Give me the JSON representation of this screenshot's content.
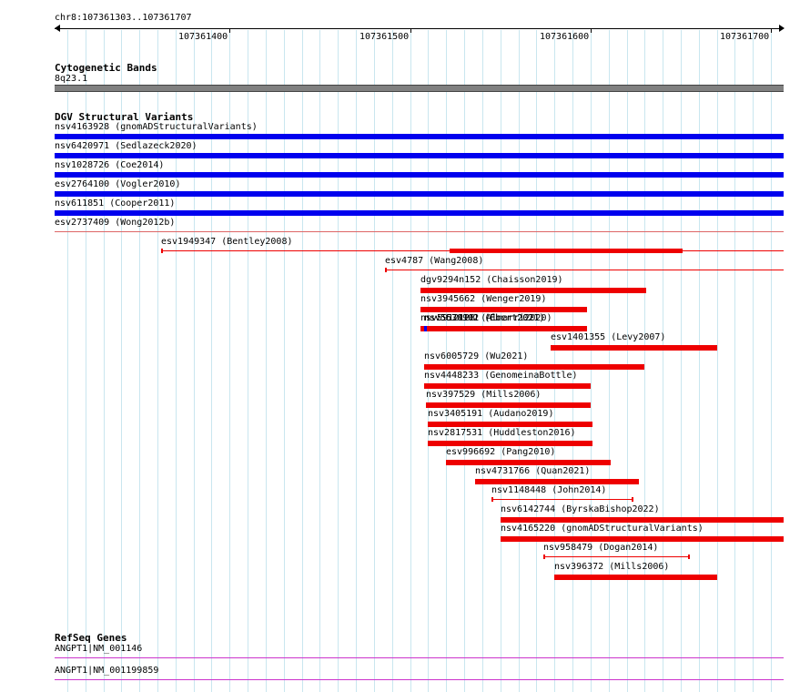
{
  "locus": "chr8:107361303..107361707",
  "scale": {
    "start": 107361303,
    "end": 107361707,
    "ticks": [
      {
        "pos": 107361400,
        "label": "107361400"
      },
      {
        "pos": 107361500,
        "label": "107361500"
      },
      {
        "pos": 107361600,
        "label": "107361600"
      },
      {
        "pos": 107361700,
        "label": "107361700"
      }
    ]
  },
  "colors": {
    "gain": "#0000ee",
    "loss": "#ee0000",
    "band": "#808080",
    "gene": "#cc33cc",
    "grid": "#c9e6ef"
  },
  "cytoband": {
    "title": "Cytogenetic Bands",
    "label": "8q23.1"
  },
  "dgv": {
    "title": "DGV Structural Variants",
    "full_span_gains": [
      {
        "label": "nsv4163928 (gnomADStructuralVariants)"
      },
      {
        "label": "nsv6420971 (Sedlazeck2020)"
      },
      {
        "label": "nsv1028726 (Coe2014)"
      },
      {
        "label": "esv2764100 (Vogler2010)"
      },
      {
        "label": "nsv611851 (Cooper2011)"
      }
    ],
    "full_span_losses": [
      {
        "label": "esv2737409 (Wong2012b)"
      }
    ],
    "features": [
      {
        "label": "esv1949347 (Bentley2008)",
        "color": "loss",
        "style": "thin",
        "start": 107361362,
        "end": 107361707,
        "thick_start": 107361522,
        "thick_end": 107361651
      },
      {
        "label": "esv4787 (Wang2008)",
        "color": "loss",
        "style": "thin",
        "start": 107361486,
        "end": 107361707
      },
      {
        "label": "dgv9294n152 (Chaisson2019)",
        "color": "loss",
        "style": "thick",
        "start": 107361506,
        "end": 107361631
      },
      {
        "label": "nsv3945662 (Wenger2019)",
        "color": "loss",
        "style": "thick",
        "start": 107361506,
        "end": 107361598
      },
      {
        "label": "nsv5912128 (Almarri2020)",
        "color": "loss",
        "style": "thick",
        "start": 107361506,
        "end": 107361597
      },
      {
        "label": "nsv5578102 (Ebert2021)",
        "color": "loss",
        "style": "thick",
        "start": 107361508,
        "end": 107361598
      },
      {
        "label": "nsv5634901 (Ebert2021)",
        "color": "gain",
        "style": "thick",
        "start": 107361508,
        "end": 107361509
      },
      {
        "label": "esv1401355 (Levy2007)",
        "color": "loss",
        "style": "thick",
        "start": 107361578,
        "end": 107361670
      },
      {
        "label": "nsv6005729 (Wu2021)",
        "color": "loss",
        "style": "thick",
        "start": 107361508,
        "end": 107361630
      },
      {
        "label": "nsv4448233 (GenomeinaBottle)",
        "color": "loss",
        "style": "thick",
        "start": 107361508,
        "end": 107361600
      },
      {
        "label": "nsv397529 (Mills2006)",
        "color": "loss",
        "style": "thick",
        "start": 107361509,
        "end": 107361600
      },
      {
        "label": "nsv3405191 (Audano2019)",
        "color": "loss",
        "style": "thick",
        "start": 107361510,
        "end": 107361601
      },
      {
        "label": "nsv2817531 (Huddleston2016)",
        "color": "loss",
        "style": "thick",
        "start": 107361510,
        "end": 107361601
      },
      {
        "label": "esv996692 (Pang2010)",
        "color": "loss",
        "style": "thick",
        "start": 107361520,
        "end": 107361611
      },
      {
        "label": "nsv4731766 (Quan2021)",
        "color": "loss",
        "style": "thick",
        "start": 107361536,
        "end": 107361627
      },
      {
        "label": "nsv1148448 (John2014)",
        "color": "loss",
        "style": "thin",
        "start": 107361545,
        "end": 107361623
      },
      {
        "label": "nsv6142744 (ByrskaBishop2022)",
        "color": "loss",
        "style": "thick",
        "start": 107361550,
        "end": 107361707
      },
      {
        "label": "nsv4165220 (gnomADStructuralVariants)",
        "color": "loss",
        "style": "thick",
        "start": 107361550,
        "end": 107361707
      },
      {
        "label": "nsv958479 (Dogan2014)",
        "color": "loss",
        "style": "thin",
        "start": 107361574,
        "end": 107361654
      },
      {
        "label": "nsv396372 (Mills2006)",
        "color": "loss",
        "style": "thick",
        "start": 107361580,
        "end": 107361670
      }
    ]
  },
  "refseq": {
    "title": "RefSeq Genes",
    "genes": [
      {
        "label": "ANGPT1|NM_001146"
      },
      {
        "label": "ANGPT1|NM_001199859"
      }
    ]
  }
}
